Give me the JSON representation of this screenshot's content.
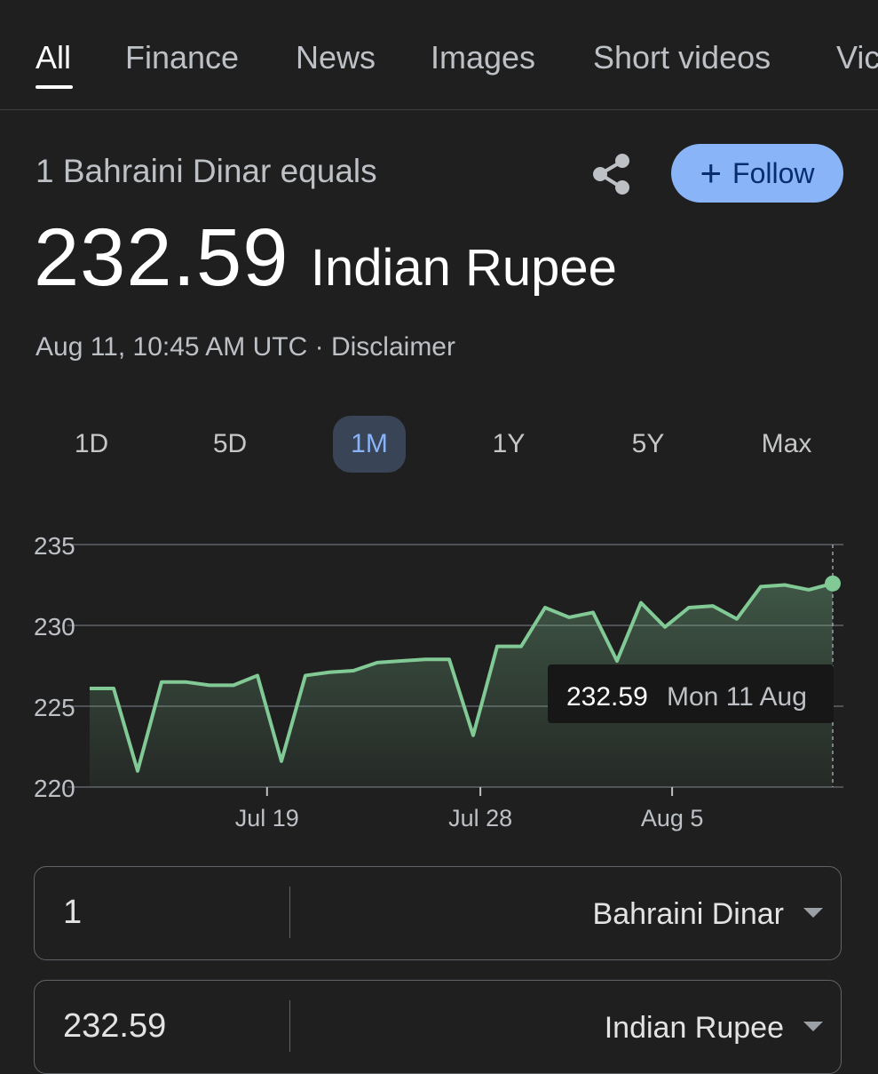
{
  "tabs": [
    {
      "label": "All",
      "active": true
    },
    {
      "label": "Finance"
    },
    {
      "label": "News"
    },
    {
      "label": "Images"
    },
    {
      "label": "Short videos"
    },
    {
      "label": "Vic"
    }
  ],
  "header": {
    "equals_label": "1 Bahraini Dinar equals",
    "share_icon": "share-icon",
    "follow_label": "Follow",
    "follow_icon": "plus-icon"
  },
  "quote": {
    "value": "232.59",
    "currency": "Indian Rupee",
    "timestamp": "Aug 11, 10:45 AM UTC",
    "separator": "·",
    "disclaimer": "Disclaimer"
  },
  "ranges": [
    {
      "label": "1D"
    },
    {
      "label": "5D"
    },
    {
      "label": "1M",
      "active": true
    },
    {
      "label": "1Y"
    },
    {
      "label": "5Y"
    },
    {
      "label": "Max"
    }
  ],
  "chart_data": {
    "type": "area",
    "y_ticks": [
      "235",
      "230",
      "225",
      "220"
    ],
    "y_tick_values": [
      235,
      230,
      225,
      220
    ],
    "ylim": [
      220,
      235
    ],
    "x_tick_labels": [
      "Jul 19",
      "Jul 28",
      "Aug 5"
    ],
    "x_tick_index": [
      7.4,
      16.3,
      24.3
    ],
    "values": [
      226.1,
      226.1,
      221.0,
      226.5,
      226.5,
      226.3,
      226.3,
      226.9,
      221.6,
      226.9,
      227.1,
      227.2,
      227.7,
      227.8,
      227.9,
      227.9,
      223.2,
      228.7,
      228.7,
      231.1,
      230.5,
      230.8,
      227.8,
      231.4,
      229.9,
      231.1,
      231.2,
      230.4,
      232.4,
      232.5,
      232.2,
      232.59
    ],
    "tooltip": {
      "value": "232.59",
      "date": "Mon 11 Aug"
    },
    "colors": {
      "line": "#81c995",
      "grid": "#5f6368",
      "tooltip_bg": "#171717"
    }
  },
  "converter": [
    {
      "amount": "1",
      "currency": "Bahraini Dinar"
    },
    {
      "amount": "232.59",
      "currency": "Indian Rupee"
    }
  ]
}
